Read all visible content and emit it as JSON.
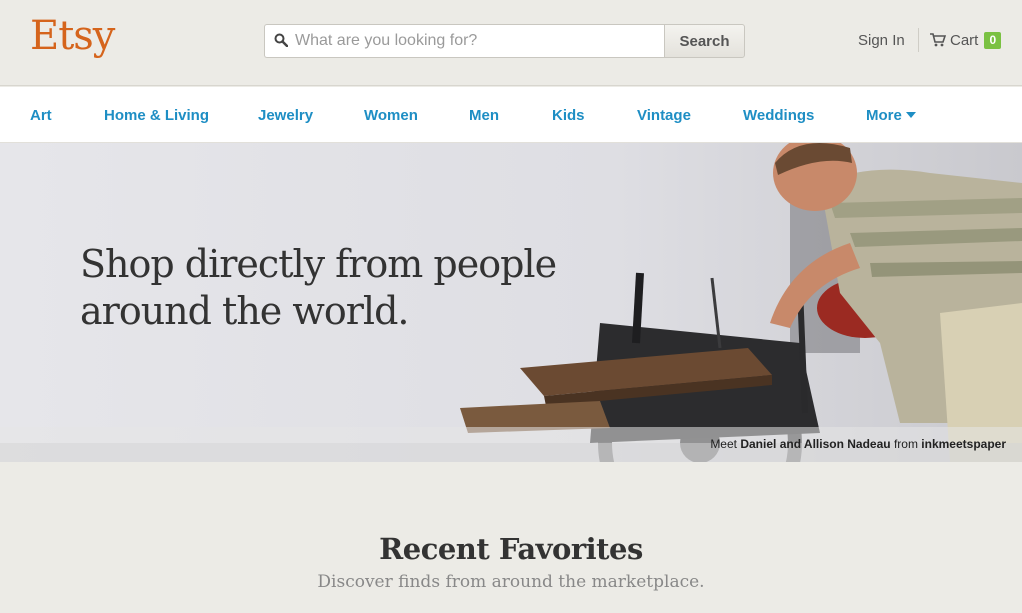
{
  "header": {
    "logo": "Etsy",
    "search_placeholder": "What are you looking for?",
    "search_button": "Search",
    "sign_in": "Sign In",
    "cart_label": "Cart",
    "cart_count": "0"
  },
  "nav": {
    "items": [
      "Art",
      "Home & Living",
      "Jewelry",
      "Women",
      "Men",
      "Kids",
      "Vintage",
      "Weddings",
      "More"
    ]
  },
  "hero": {
    "title_line1": "Shop directly from people",
    "title_line2": "around the world.",
    "caption_prefix": "Meet",
    "caption_people": "Daniel and Allison Nadeau",
    "caption_mid": "from",
    "caption_shop": "inkmeetspaper"
  },
  "favorites": {
    "title": "Recent Favorites",
    "subtitle": "Discover finds from around the marketplace."
  },
  "colors": {
    "brand_orange": "#d5641c",
    "nav_blue": "#1e8ec4",
    "cart_badge_green": "#7ac142",
    "page_bg": "#ecebe6"
  }
}
